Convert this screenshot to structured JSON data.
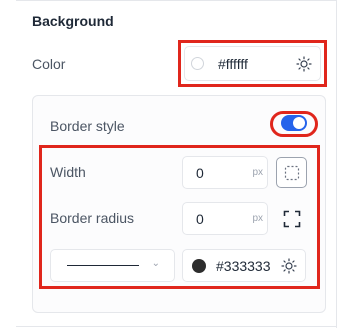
{
  "section": {
    "title": "Background"
  },
  "background_color": {
    "label": "Color",
    "value": "#ffffff",
    "swatch": "#ffffff"
  },
  "border": {
    "style_label": "Border style",
    "enabled": true,
    "width": {
      "label": "Width",
      "value": "0",
      "unit": "px"
    },
    "radius": {
      "label": "Border radius",
      "value": "0",
      "unit": "px"
    },
    "line_style": "solid",
    "color": {
      "value": "#333333",
      "swatch": "#2d2d2d"
    }
  },
  "colors": {
    "accent": "#2563eb",
    "highlight": "#e0261c"
  },
  "icons": {
    "color_picker": "sun-icon",
    "border_toggle": "dashed-square-icon",
    "radius": "corners-icon",
    "dropdown": "chevron-down-icon"
  }
}
